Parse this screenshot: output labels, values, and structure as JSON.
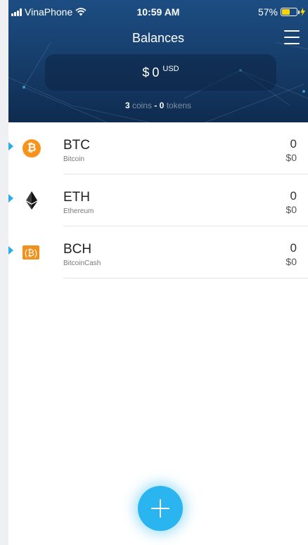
{
  "status_bar": {
    "carrier": "VinaPhone",
    "time": "10:59 AM",
    "battery_percent": "57%",
    "battery_level": 0.57
  },
  "header": {
    "title": "Balances",
    "balance_symbol": "$",
    "balance_value": "0",
    "balance_currency": "USD",
    "coins_count": "3",
    "coins_label": "coins",
    "separator": "-",
    "tokens_count": "0",
    "tokens_label": "tokens"
  },
  "colors": {
    "header_top": "#1c4d82",
    "header_bottom": "#0f2b4f",
    "accent": "#2bb5f0",
    "btc": "#f7931a",
    "bch": "#f0911d"
  },
  "assets": [
    {
      "symbol": "BTC",
      "name": "Bitcoin",
      "amount": "0",
      "fiat": "$0",
      "icon": "bitcoin-icon",
      "glyph": "₿"
    },
    {
      "symbol": "ETH",
      "name": "Ethereum",
      "amount": "0",
      "fiat": "$0",
      "icon": "ethereum-icon",
      "glyph": ""
    },
    {
      "symbol": "BCH",
      "name": "BitcoinCash",
      "amount": "0",
      "fiat": "$0",
      "icon": "bitcoin-cash-icon",
      "glyph": "(₿)"
    }
  ]
}
